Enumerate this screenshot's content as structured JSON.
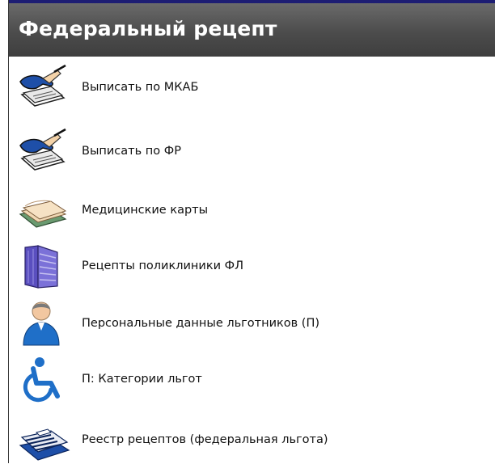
{
  "panel": {
    "title": "Федеральный рецепт"
  },
  "items": [
    {
      "label": "Выписать по МКАБ",
      "icon": "writing-hand-icon"
    },
    {
      "label": "Выписать по ФР",
      "icon": "writing-hand-icon"
    },
    {
      "label": "Медицинские карты",
      "icon": "medical-cards-icon"
    },
    {
      "label": "Рецепты поликлиники ФЛ",
      "icon": "recipes-folder-icon"
    },
    {
      "label": "Персональные данные льготников (П)",
      "icon": "person-icon"
    },
    {
      "label": "П: Категории льгот",
      "icon": "wheelchair-icon"
    },
    {
      "label": "Реестр рецептов (федеральная льгота)",
      "icon": "card-register-icon"
    }
  ],
  "colors": {
    "header_gradient_top": "#6a6a6a",
    "header_gradient_bottom": "#3e3e3e",
    "header_top_border": "#1d1d73",
    "accent_blue": "#1f6fc8"
  }
}
